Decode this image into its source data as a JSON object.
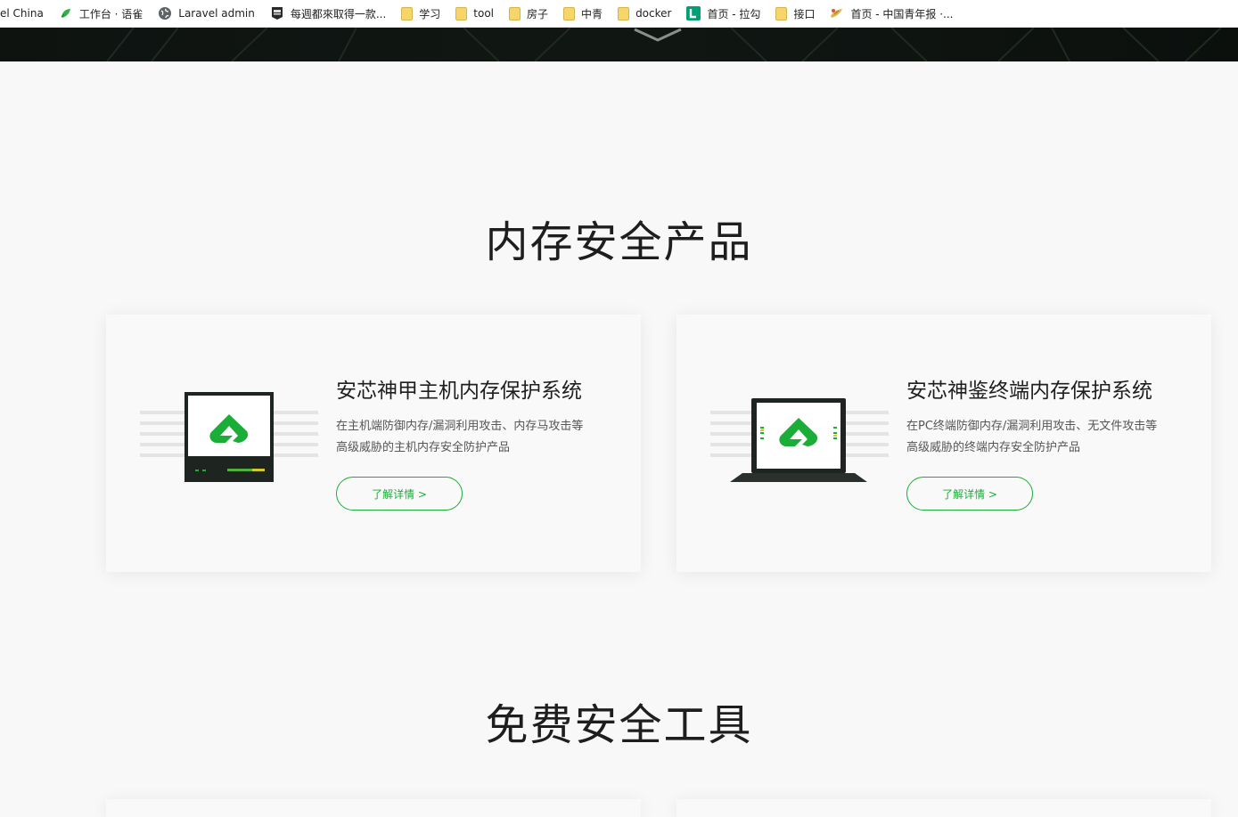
{
  "bookmarks": [
    {
      "label": "el China",
      "icon": "none"
    },
    {
      "label": "工作台 · 语雀",
      "icon": "yuque-icon"
    },
    {
      "label": "Laravel admin",
      "icon": "globe-icon"
    },
    {
      "label": "每週都來取得一款...",
      "icon": "epic-icon"
    },
    {
      "label": "学习",
      "icon": "folder-icon"
    },
    {
      "label": "tool",
      "icon": "folder-icon"
    },
    {
      "label": "房子",
      "icon": "folder-icon"
    },
    {
      "label": "中青",
      "icon": "folder-icon"
    },
    {
      "label": "docker",
      "icon": "folder-icon"
    },
    {
      "label": "首页 - 拉勾",
      "icon": "lagou-icon"
    },
    {
      "label": "接口",
      "icon": "folder-icon"
    },
    {
      "label": "首页 - 中国青年报 ·...",
      "icon": "news-icon"
    }
  ],
  "sections": {
    "memory_title": "内存安全产品",
    "tools_title": "免费安全工具"
  },
  "products": [
    {
      "title": "安芯神甲主机内存保护系统",
      "desc_line1": "在主机端防御内存/漏洞利用攻击、内存马攻击等",
      "desc_line2": "高级威胁的主机内存安全防护产品",
      "button": "了解详情 >",
      "illustration": "server-icon"
    },
    {
      "title": "安芯神鉴终端内存保护系统",
      "desc_line1": "在PC终端防御内存/漏洞利用攻击、无文件攻击等",
      "desc_line2": "高级威胁的终端内存安全防护产品",
      "button": "了解详情 >",
      "illustration": "laptop-icon"
    }
  ],
  "colors": {
    "accent": "#1aad38",
    "page_bg": "#f8f8f8",
    "hero_bg": "#0b0e0c"
  }
}
